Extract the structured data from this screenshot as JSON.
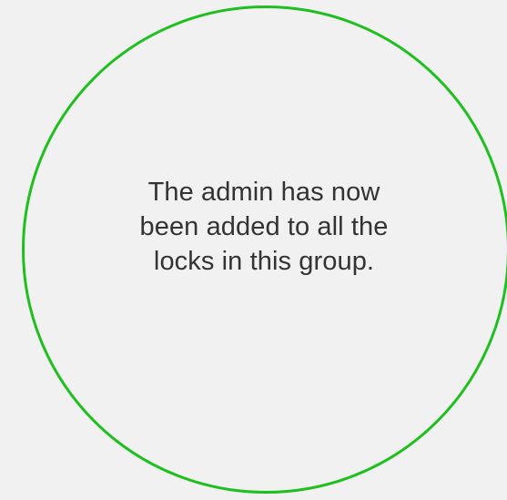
{
  "status_screen": {
    "accent_color": "#1fbf1f",
    "background_color": "#f1f1f1",
    "message_lines": [
      "The admin has now",
      "been added to all the",
      "locks in this group."
    ]
  }
}
